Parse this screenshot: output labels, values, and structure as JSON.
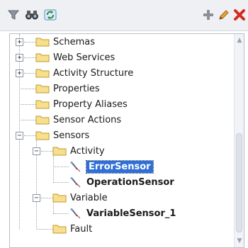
{
  "toolbar": {
    "left_icons": [
      "filter-icon",
      "binoculars-icon",
      "refresh-icon"
    ],
    "right_icons": [
      "add-icon",
      "edit-icon",
      "delete-icon"
    ]
  },
  "tree": {
    "items": [
      {
        "label": "Schemas",
        "type": "folder",
        "expander": "+"
      },
      {
        "label": "Web Services",
        "type": "folder",
        "expander": "+"
      },
      {
        "label": "Activity Structure",
        "type": "folder",
        "expander": "+"
      },
      {
        "label": "Properties",
        "type": "folder",
        "expander": ""
      },
      {
        "label": "Property Aliases",
        "type": "folder",
        "expander": ""
      },
      {
        "label": "Sensor Actions",
        "type": "folder",
        "expander": ""
      },
      {
        "label": "Sensors",
        "type": "folder",
        "expander": "−"
      },
      {
        "label": "Activity",
        "type": "folder",
        "expander": "−"
      },
      {
        "label": "ErrorSensor",
        "type": "sensor",
        "selected": true
      },
      {
        "label": "OperationSensor",
        "type": "sensor"
      },
      {
        "label": "Variable",
        "type": "folder",
        "expander": "−"
      },
      {
        "label": "VariableSensor_1",
        "type": "sensor"
      },
      {
        "label": "Fault",
        "type": "folder",
        "expander": ""
      }
    ]
  },
  "colors": {
    "selection": "#2f6fd6",
    "folder_fill": "#f6df8d",
    "folder_edge": "#c49a2a",
    "add_green": "#3a9a3a",
    "delete_red": "#d42a1e"
  }
}
